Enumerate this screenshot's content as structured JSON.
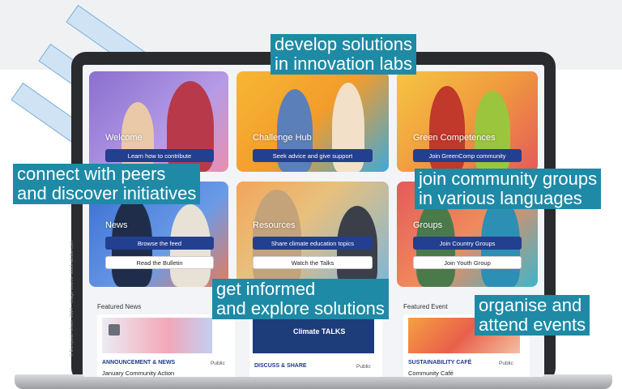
{
  "callouts": {
    "labs_line1": "develop solutions",
    "labs_line2": "in innovation labs",
    "peers_line1": "connect with peers",
    "peers_line2": "and discover initiatives",
    "groups_line1": "join community groups",
    "groups_line2": "in various languages",
    "informed_line1": "get informed",
    "informed_line2": "and explore solutions",
    "events_line1": "organise and",
    "events_line2": "attend events"
  },
  "tiles": {
    "welcome": {
      "title": "Welcome",
      "button": "Learn how to contribute"
    },
    "challenge": {
      "title": "Challenge Hub",
      "button": "Seek advice and give support"
    },
    "green": {
      "title": "Green Competences",
      "button": "Join GreenComp community"
    },
    "news": {
      "title": "News",
      "button1": "Browse the feed",
      "button2": "Read the Bulletin"
    },
    "resources": {
      "title": "Resources",
      "button1": "Share climate education topics",
      "button2": "Watch the Talks"
    },
    "groups": {
      "title": "Groups",
      "button1": "Join Country Groups",
      "button2": "Join Youth Group"
    }
  },
  "featured": {
    "news_heading": "Featured News",
    "event_heading": "Featured Event",
    "card1": {
      "tag": "ANNOUNCEMENT & NEWS",
      "visibility": "Public",
      "title": "January Community Action"
    },
    "card2": {
      "tag": "DISCUSS & SHARE",
      "visibility": "Public",
      "banner": "Climate TALKS"
    },
    "card3": {
      "tag": "SUSTAINABILITY CAFÉ",
      "visibility": "Public",
      "title": "Community Café"
    }
  },
  "credit": "© European Union, 2024 - image source: stock.adobe.com",
  "colors": {
    "callout": "#1e8aa6",
    "button": "#233f8f",
    "deco": "#cfe3f5"
  }
}
